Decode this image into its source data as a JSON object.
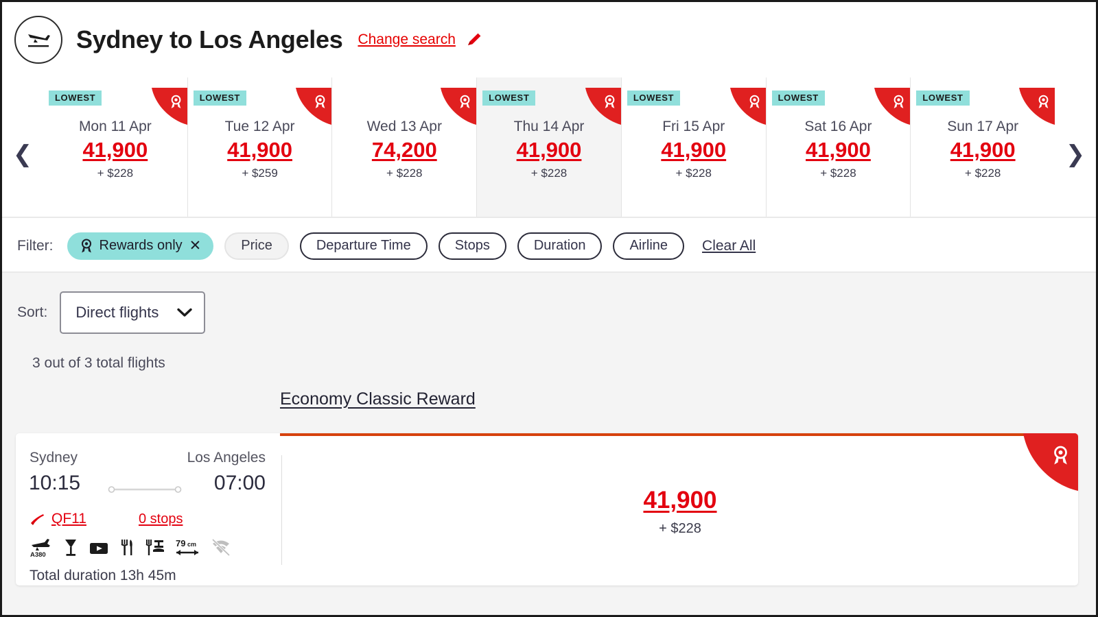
{
  "header": {
    "plane_icon": "plane-takeoff-icon",
    "route_title": "Sydney to Los Angeles",
    "change_search_label": "Change search",
    "pencil_icon": "pencil-edit-icon"
  },
  "date_strip": {
    "prev_icon": "chevron-left-icon",
    "next_icon": "chevron-right-icon",
    "badge_label": "LOWEST",
    "ribbon_icon": "reward-ribbon-icon",
    "cells": [
      {
        "date": "Mon 11 Apr",
        "points": "41,900",
        "cash": "+ $228",
        "lowest": true,
        "selected": false
      },
      {
        "date": "Tue 12 Apr",
        "points": "41,900",
        "cash": "+ $259",
        "lowest": true,
        "selected": false
      },
      {
        "date": "Wed 13 Apr",
        "points": "74,200",
        "cash": "+ $228",
        "lowest": false,
        "selected": false
      },
      {
        "date": "Thu 14 Apr",
        "points": "41,900",
        "cash": "+ $228",
        "lowest": true,
        "selected": true
      },
      {
        "date": "Fri 15 Apr",
        "points": "41,900",
        "cash": "+ $228",
        "lowest": true,
        "selected": false
      },
      {
        "date": "Sat 16 Apr",
        "points": "41,900",
        "cash": "+ $228",
        "lowest": true,
        "selected": false
      },
      {
        "date": "Sun 17 Apr",
        "points": "41,900",
        "cash": "+ $228",
        "lowest": true,
        "selected": false
      }
    ]
  },
  "filter": {
    "label": "Filter:",
    "rewards_only": "Rewards only",
    "rewards_icon": "reward-ribbon-icon",
    "close_icon": "✕",
    "chips": [
      "Price",
      "Departure Time",
      "Stops",
      "Duration",
      "Airline"
    ],
    "clear_all": "Clear All"
  },
  "sort": {
    "label": "Sort:",
    "value": "Direct flights",
    "chevron_icon": "chevron-down-icon"
  },
  "results": {
    "count_text": "3 out of 3 total flights",
    "fare_tab": "Economy Classic Reward"
  },
  "flight": {
    "origin_city": "Sydney",
    "dest_city": "Los Angeles",
    "depart_time": "10:15",
    "arrive_time": "07:00",
    "flight_number": "QF11",
    "airline_icon": "qantas-tail-icon",
    "stops": "0 stops",
    "total_duration": "Total duration 13h 45m",
    "amenities": [
      {
        "name": "aircraft-a380-icon",
        "label": "A380",
        "available": true
      },
      {
        "name": "beverage-icon",
        "label": "",
        "available": true
      },
      {
        "name": "inflight-entertainment-icon",
        "label": "",
        "available": true
      },
      {
        "name": "meal-icon",
        "label": "",
        "available": true
      },
      {
        "name": "meal-service-icon",
        "label": "",
        "available": true
      },
      {
        "name": "seat-pitch-icon",
        "label": "79cm",
        "available": true
      },
      {
        "name": "wifi-unavailable-icon",
        "label": "",
        "available": false
      }
    ],
    "fare_points": "41,900",
    "fare_cash": "+ $228",
    "ribbon_icon": "reward-ribbon-icon"
  },
  "colors": {
    "brand_red": "#e3000f",
    "ribbon_red": "#e02020",
    "teal_badge": "#90dfdb",
    "fare_border": "#d6410d",
    "results_bg": "#f4f4f4"
  }
}
